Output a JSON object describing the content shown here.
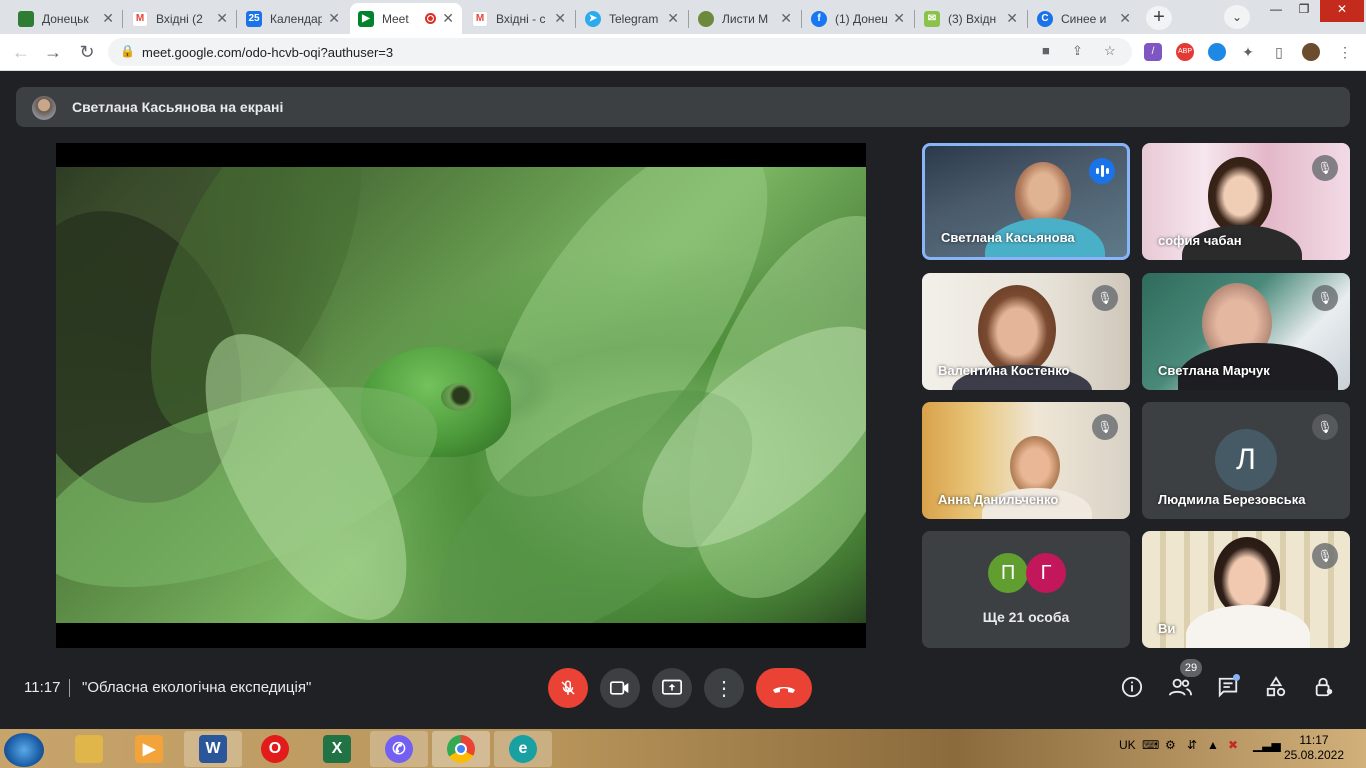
{
  "browser": {
    "tabs": [
      {
        "label": "Донецьк",
        "favicon": "shield-icon",
        "color": "#2e7d32"
      },
      {
        "label": "Вхідні (2",
        "favicon": "gmail-icon",
        "color": "#ea4335"
      },
      {
        "label": "Календар",
        "favicon": "calendar-icon",
        "color": "#1a73e8",
        "favtext": "25"
      },
      {
        "label": "Meet",
        "favicon": "meet-icon",
        "color": "#00832d"
      },
      {
        "label": "Вхідні - с",
        "favicon": "gmail-icon",
        "color": "#ea4335"
      },
      {
        "label": "Telegram",
        "favicon": "telegram-icon",
        "color": "#2aabee"
      },
      {
        "label": "Листи М",
        "favicon": "mail-icon",
        "color": "#6d8a3c"
      },
      {
        "label": "(1) Донец",
        "favicon": "facebook-icon",
        "color": "#1877f2"
      },
      {
        "label": "(3) Вхідн",
        "favicon": "mail-icon",
        "color": "#8bc34a"
      },
      {
        "label": "Синее и",
        "favicon": "c-icon",
        "color": "#1a73e8"
      }
    ],
    "url": "meet.google.com/odo-hcvb-oqi?authuser=3",
    "extensions": [
      {
        "name": "pen-icon",
        "color": "#7e57c2"
      },
      {
        "name": "abp-icon",
        "color": "#e53935",
        "text": "ABP"
      },
      {
        "name": "circle-icon",
        "color": "#1e88e5"
      }
    ]
  },
  "meet": {
    "presenting_label": "Светлана Касьянова на екрані",
    "participants": [
      {
        "name": "Светлана Касьянова",
        "state": "speaking"
      },
      {
        "name": "софия чабан",
        "state": "muted"
      },
      {
        "name": "Валентина Костенко",
        "state": "muted"
      },
      {
        "name": "Светлана Марчук",
        "state": "muted"
      },
      {
        "name": "Анна Данильченко",
        "state": "muted"
      },
      {
        "name": "Людмила Березовська",
        "state": "muted",
        "initial": "Л"
      },
      {
        "name": "Ви",
        "state": "muted"
      }
    ],
    "others": {
      "label": "Ще 21 особа",
      "initials": [
        "П",
        "Г"
      ],
      "colors": [
        "#5f9e2f",
        "#c2185b"
      ]
    },
    "time": "11:17",
    "meeting_name": "\"Обласна екологічна експедиція\"",
    "people_count": "29"
  },
  "taskbar": {
    "lang": "UK",
    "clock_time": "11:17",
    "clock_date": "25.08.2022",
    "apps": [
      {
        "name": "explorer-icon",
        "color": "#e0b64a",
        "text": ""
      },
      {
        "name": "media-player-icon",
        "color": "#f2a33a",
        "text": "▶"
      },
      {
        "name": "word-icon",
        "color": "#2b579a",
        "text": "W"
      },
      {
        "name": "opera-icon",
        "color": "#e21b1b",
        "text": "O"
      },
      {
        "name": "excel-icon",
        "color": "#217346",
        "text": "X"
      },
      {
        "name": "viber-icon",
        "color": "#7360f2",
        "text": "✆"
      },
      {
        "name": "chrome-icon",
        "color": "#4285f4",
        "text": "●"
      },
      {
        "name": "eset-icon",
        "color": "#19a0a0",
        "text": "e"
      }
    ]
  }
}
